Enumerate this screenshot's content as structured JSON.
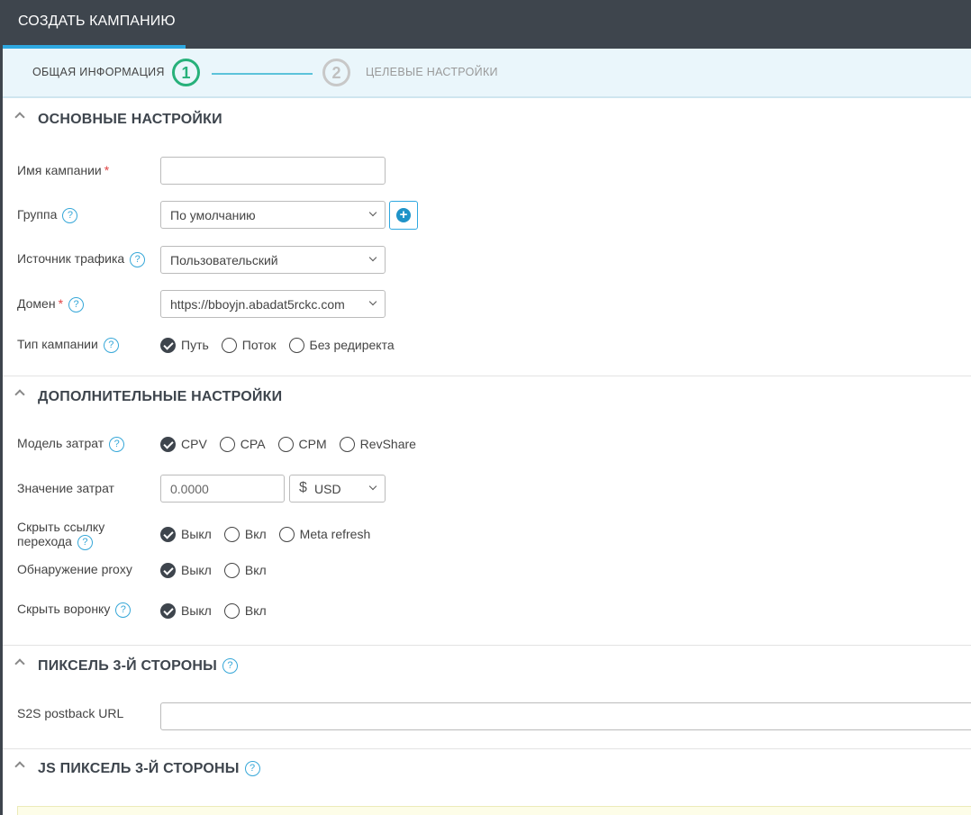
{
  "header": {
    "tab_title": "СОЗДАТЬ КАМПАНИЮ"
  },
  "wizard": {
    "step1": {
      "number": "1",
      "label": "ОБЩАЯ ИНФОРМАЦИЯ"
    },
    "step2": {
      "number": "2",
      "label": "ЦЕЛЕВЫЕ НАСТРОЙКИ"
    }
  },
  "basic": {
    "title": "ОСНОВНЫЕ НАСТРОЙКИ",
    "campaign_name_label": "Имя кампании",
    "campaign_name_value": "",
    "group_label": "Группа",
    "group_value": "По умолчанию",
    "traffic_label": "Источник трафика",
    "traffic_value": "Пользовательский",
    "domain_label": "Домен",
    "domain_value": "https://bboyjn.abadat5rckc.com",
    "type_label": "Тип кампании",
    "type_options": [
      "Путь",
      "Поток",
      "Без редиректа"
    ],
    "type_selected": "Путь"
  },
  "extra": {
    "title": "ДОПОЛНИТЕЛЬНЫЕ НАСТРОЙКИ",
    "cost_model_label": "Модель затрат",
    "cost_model_options": [
      "CPV",
      "CPA",
      "CPM",
      "RevShare"
    ],
    "cost_model_selected": "CPV",
    "cost_value_label": "Значение затрат",
    "cost_value": "0.0000",
    "currency_symbol": "$",
    "currency_value": "USD",
    "hide_link_label_line1": "Скрыть ссылку",
    "hide_link_label_line2": "перехода",
    "hide_link_options": [
      "Выкл",
      "Вкл",
      "Meta refresh"
    ],
    "hide_link_selected": "Выкл",
    "proxy_label": "Обнаружение proxy",
    "proxy_options": [
      "Выкл",
      "Вкл"
    ],
    "proxy_selected": "Выкл",
    "hide_funnel_label": "Скрыть воронку",
    "hide_funnel_options": [
      "Выкл",
      "Вкл"
    ],
    "hide_funnel_selected": "Выкл"
  },
  "pixel": {
    "title": "ПИКСЕЛЬ 3-Й СТОРОНЫ",
    "s2s_label": "S2S postback URL",
    "s2s_value": ""
  },
  "js_pixel": {
    "title": "JS ПИКСЕЛЬ 3-Й СТОРОНЫ"
  },
  "help_glyph": "?",
  "required_mark": "*",
  "add_glyph": "+",
  "colors": {
    "header_bg": "#3e454d",
    "accent": "#2ea8e0",
    "step_active": "#27b17a",
    "required": "#e04444"
  }
}
